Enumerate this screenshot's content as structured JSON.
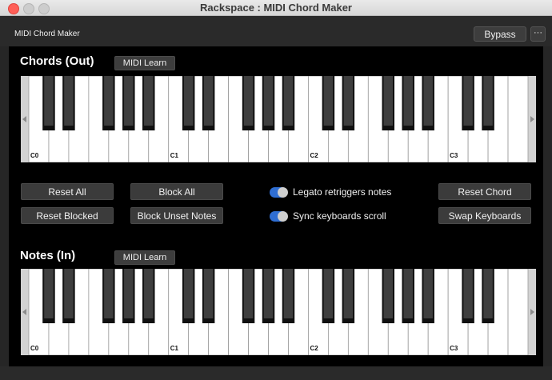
{
  "window": {
    "title": "Rackspace : MIDI Chord Maker"
  },
  "header": {
    "plugin_name": "MIDI Chord Maker",
    "bypass_label": "Bypass",
    "more_label": "···"
  },
  "chords": {
    "title": "Chords (Out)",
    "midi_learn_label": "MIDI Learn",
    "octave_labels": [
      "C0",
      "C1",
      "C2",
      "C3"
    ]
  },
  "notes": {
    "title": "Notes (In)",
    "midi_learn_label": "MIDI Learn",
    "octave_labels": [
      "C0",
      "C1",
      "C2",
      "C3"
    ]
  },
  "controls": {
    "reset_all": "Reset All",
    "block_all": "Block All",
    "reset_blocked": "Reset Blocked",
    "block_unset_notes": "Block Unset Notes",
    "reset_chord": "Reset Chord",
    "swap_keyboards": "Swap Keyboards",
    "toggles": [
      {
        "label": "Legato retriggers notes",
        "on": true
      },
      {
        "label": "Sync keyboards scroll",
        "on": true
      }
    ]
  },
  "colors": {
    "toggle_on": "#2f6ed3",
    "background": "#000000"
  }
}
